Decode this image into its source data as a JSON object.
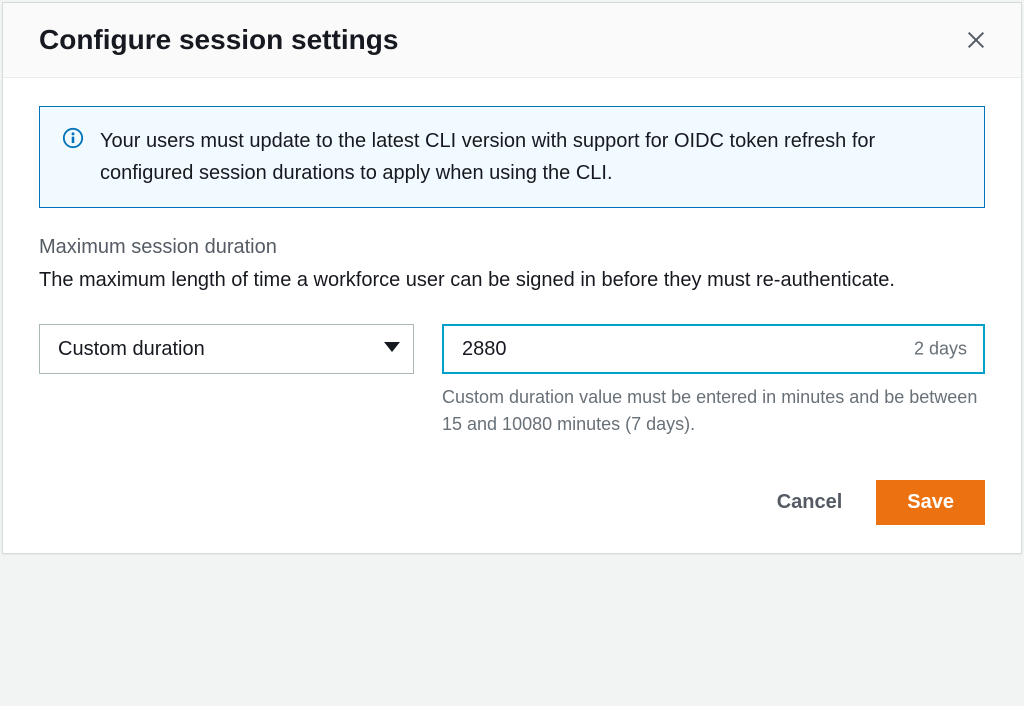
{
  "dialog": {
    "title": "Configure session settings",
    "info_banner": "Your users must update to the latest CLI version with support for OIDC token refresh for configured session durations to apply when using the CLI.",
    "field": {
      "label": "Maximum session duration",
      "description": "The maximum length of time a workforce user can be signed in before they must re-authenticate."
    },
    "select": {
      "selected": "Custom duration"
    },
    "duration_input": {
      "value": "2880",
      "suffix": "2 days",
      "hint": "Custom duration value must be entered in minutes and be between 15 and 10080 minutes (7 days)."
    },
    "footer": {
      "cancel": "Cancel",
      "save": "Save"
    }
  }
}
